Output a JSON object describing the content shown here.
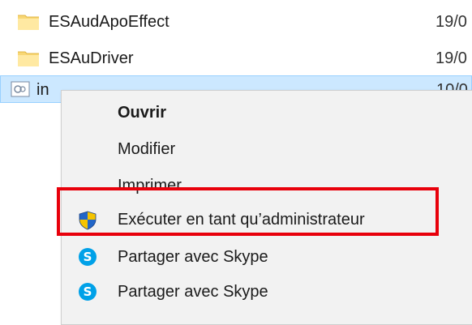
{
  "files": [
    {
      "name": "ESAudApoEffect",
      "date": "19/0",
      "icon": "folder-icon"
    },
    {
      "name": "ESAuDriver",
      "date": "19/0",
      "icon": "folder-icon"
    },
    {
      "name": "in",
      "date": "10/0",
      "icon": "setup-information-file-icon",
      "selected": true
    }
  ],
  "context_menu": {
    "items": [
      {
        "label": "Ouvrir",
        "bold": true
      },
      {
        "label": "Modifier"
      },
      {
        "label": "Imprimer"
      },
      {
        "label": "Exécuter en tant qu’administrateur",
        "icon": "uac-shield-icon",
        "highlighted": true
      },
      {
        "label": "Partager avec Skype",
        "icon": "skype-icon"
      },
      {
        "label": "Partager avec Skype",
        "icon": "skype-icon"
      }
    ]
  },
  "colors": {
    "selection_bg": "#cce8ff",
    "highlight_border": "#e8000b",
    "menu_bg": "#f2f2f2",
    "skype": "#00a1e8"
  },
  "icons": {
    "skype_letter": "S"
  }
}
